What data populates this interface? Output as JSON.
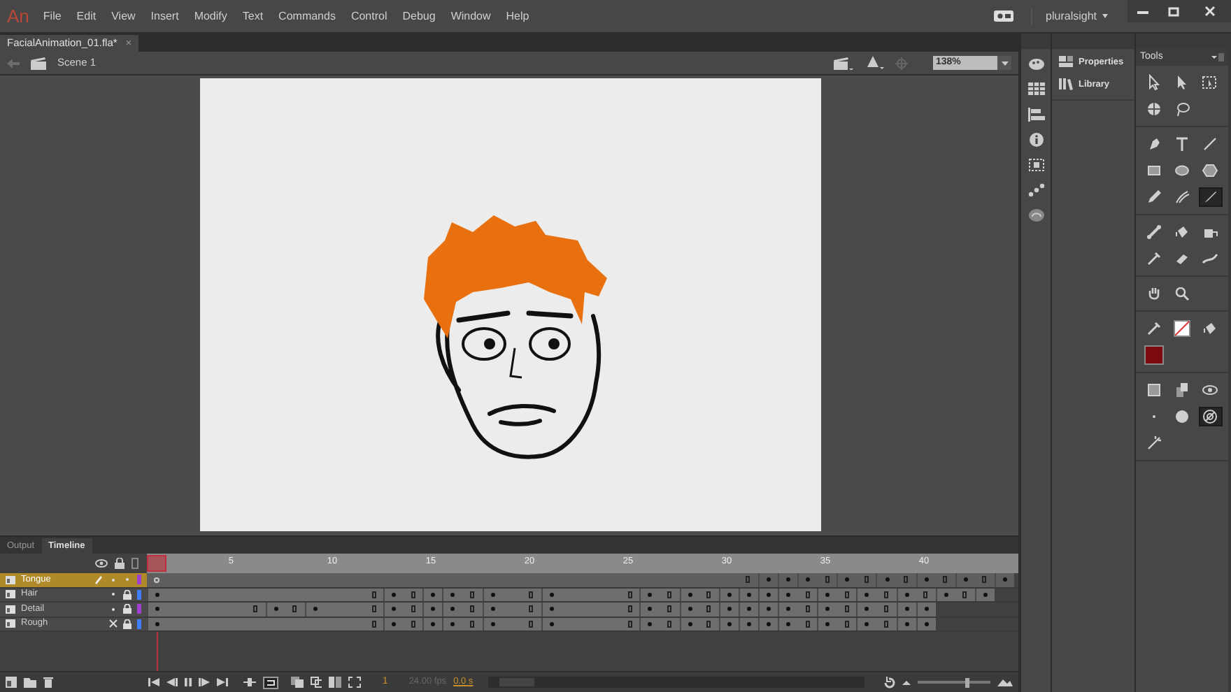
{
  "app": {
    "logo": "An",
    "menus": [
      "File",
      "Edit",
      "View",
      "Insert",
      "Modify",
      "Text",
      "Commands",
      "Control",
      "Debug",
      "Window",
      "Help"
    ],
    "account": "pluralsight"
  },
  "document_tab": {
    "title": "FacialAnimation_01.fla*",
    "close": "×"
  },
  "scene_bar": {
    "scene": "Scene 1",
    "zoom": "138%"
  },
  "dock_icons": [
    {
      "kind": "palette"
    },
    {
      "kind": "grid"
    },
    {
      "kind": "align"
    },
    {
      "kind": "info"
    },
    {
      "kind": "transform"
    },
    {
      "kind": "motion"
    },
    {
      "kind": "cloud"
    }
  ],
  "panels": [
    {
      "label": "Properties",
      "kind": "properties"
    },
    {
      "label": "Library",
      "kind": "library"
    }
  ],
  "tools": {
    "title": "Tools",
    "groups": [
      [
        {
          "kind": "select",
          "selected": false
        },
        {
          "kind": "subselect",
          "selected": false
        },
        {
          "kind": "transform",
          "selected": false
        },
        {
          "kind": "rotate3d",
          "selected": false
        },
        {
          "kind": "lasso",
          "selected": false
        }
      ],
      [
        {
          "kind": "pen",
          "selected": false
        },
        {
          "kind": "text",
          "selected": false
        },
        {
          "kind": "line",
          "selected": false
        },
        {
          "kind": "rect",
          "selected": false
        },
        {
          "kind": "oval",
          "selected": false
        },
        {
          "kind": "poly",
          "selected": false
        },
        {
          "kind": "pencil",
          "selected": false
        },
        {
          "kind": "paintbrush",
          "selected": false
        },
        {
          "kind": "brush",
          "selected": true
        }
      ],
      [
        {
          "kind": "bone",
          "selected": false
        },
        {
          "kind": "bucket",
          "selected": false
        },
        {
          "kind": "inkbottle",
          "selected": false
        },
        {
          "kind": "eyedropper",
          "selected": false
        },
        {
          "kind": "eraser",
          "selected": false
        },
        {
          "kind": "width",
          "selected": false
        }
      ],
      [
        {
          "kind": "hand",
          "selected": false
        },
        {
          "kind": "zoom",
          "selected": false
        }
      ],
      [
        {
          "kind": "eyedropper",
          "selected": false
        },
        {
          "kind": "noswatch",
          "selected": false
        },
        {
          "kind": "bucket",
          "selected": false
        },
        {
          "kind": "swatch",
          "color": "#7a0a0e"
        }
      ],
      [
        {
          "kind": "objectdraw",
          "selected": false
        },
        {
          "kind": "layerdepth",
          "selected": false
        },
        {
          "kind": "tilt",
          "selected": false
        },
        {
          "kind": "dot",
          "selected": false
        },
        {
          "kind": "circle",
          "selected": false
        },
        {
          "kind": "target",
          "selected": true
        },
        {
          "kind": "wand",
          "selected": false
        }
      ]
    ]
  },
  "timeline": {
    "tabs": [
      {
        "label": "Output",
        "selected": false
      },
      {
        "label": "Timeline",
        "selected": true
      }
    ],
    "ruler": [
      "5",
      "10",
      "15",
      "20",
      "25",
      "30",
      "35",
      "40"
    ],
    "layers": [
      {
        "name": "Tongue",
        "selected": true,
        "visible": true,
        "locked": false,
        "color": "#a040d0",
        "frames": [
          {
            "kind": "blank"
          },
          {
            "kind": "span"
          },
          {
            "kind": "span"
          },
          {
            "kind": "span"
          },
          {
            "kind": "span"
          },
          {
            "kind": "span"
          },
          {
            "kind": "span"
          },
          {
            "kind": "span"
          },
          {
            "kind": "span"
          },
          {
            "kind": "span"
          },
          {
            "kind": "span"
          },
          {
            "kind": "span"
          },
          {
            "kind": "span"
          },
          {
            "kind": "span"
          },
          {
            "kind": "span"
          },
          {
            "kind": "span"
          },
          {
            "kind": "span"
          },
          {
            "kind": "span"
          },
          {
            "kind": "span"
          },
          {
            "kind": "span"
          },
          {
            "kind": "span"
          },
          {
            "kind": "span"
          },
          {
            "kind": "span"
          },
          {
            "kind": "span"
          },
          {
            "kind": "span"
          },
          {
            "kind": "span"
          },
          {
            "kind": "span"
          },
          {
            "kind": "span"
          },
          {
            "kind": "span"
          },
          {
            "kind": "span"
          },
          {
            "kind": "end"
          },
          {
            "kind": "key"
          },
          {
            "kind": "key"
          },
          {
            "kind": "key"
          },
          {
            "kind": "end"
          },
          {
            "kind": "key"
          },
          {
            "kind": "end"
          },
          {
            "kind": "key"
          },
          {
            "kind": "end"
          },
          {
            "kind": "key"
          },
          {
            "kind": "end"
          },
          {
            "kind": "key"
          },
          {
            "kind": "end"
          },
          {
            "kind": "key"
          }
        ]
      },
      {
        "name": "Hair",
        "selected": false,
        "visible": true,
        "locked": true,
        "color": "#3f7fff",
        "frames": [
          {
            "kind": "key"
          },
          {
            "kind": "span"
          },
          {
            "kind": "span"
          },
          {
            "kind": "span"
          },
          {
            "kind": "span"
          },
          {
            "kind": "span"
          },
          {
            "kind": "span"
          },
          {
            "kind": "span"
          },
          {
            "kind": "span"
          },
          {
            "kind": "span"
          },
          {
            "kind": "span"
          },
          {
            "kind": "end"
          },
          {
            "kind": "key"
          },
          {
            "kind": "end"
          },
          {
            "kind": "key"
          },
          {
            "kind": "key"
          },
          {
            "kind": "end"
          },
          {
            "kind": "key"
          },
          {
            "kind": "span"
          },
          {
            "kind": "end"
          },
          {
            "kind": "key"
          },
          {
            "kind": "span"
          },
          {
            "kind": "span"
          },
          {
            "kind": "span"
          },
          {
            "kind": "end"
          },
          {
            "kind": "key"
          },
          {
            "kind": "end"
          },
          {
            "kind": "key"
          },
          {
            "kind": "end"
          },
          {
            "kind": "key"
          },
          {
            "kind": "key"
          },
          {
            "kind": "key"
          },
          {
            "kind": "key"
          },
          {
            "kind": "end"
          },
          {
            "kind": "key"
          },
          {
            "kind": "end"
          },
          {
            "kind": "key"
          },
          {
            "kind": "end"
          },
          {
            "kind": "key"
          },
          {
            "kind": "end"
          },
          {
            "kind": "key"
          },
          {
            "kind": "end"
          },
          {
            "kind": "key"
          },
          {
            "kind": "none"
          }
        ]
      },
      {
        "name": "Detail",
        "selected": false,
        "visible": true,
        "locked": true,
        "color": "#a040d0",
        "frames": [
          {
            "kind": "key"
          },
          {
            "kind": "span"
          },
          {
            "kind": "span"
          },
          {
            "kind": "span"
          },
          {
            "kind": "span"
          },
          {
            "kind": "end"
          },
          {
            "kind": "key"
          },
          {
            "kind": "end"
          },
          {
            "kind": "key"
          },
          {
            "kind": "span"
          },
          {
            "kind": "span"
          },
          {
            "kind": "end"
          },
          {
            "kind": "key"
          },
          {
            "kind": "end"
          },
          {
            "kind": "key"
          },
          {
            "kind": "key"
          },
          {
            "kind": "end"
          },
          {
            "kind": "key"
          },
          {
            "kind": "span"
          },
          {
            "kind": "end"
          },
          {
            "kind": "key"
          },
          {
            "kind": "span"
          },
          {
            "kind": "span"
          },
          {
            "kind": "span"
          },
          {
            "kind": "end"
          },
          {
            "kind": "key"
          },
          {
            "kind": "end"
          },
          {
            "kind": "key"
          },
          {
            "kind": "end"
          },
          {
            "kind": "key"
          },
          {
            "kind": "key"
          },
          {
            "kind": "key"
          },
          {
            "kind": "key"
          },
          {
            "kind": "end"
          },
          {
            "kind": "key"
          },
          {
            "kind": "end"
          },
          {
            "kind": "key"
          },
          {
            "kind": "end"
          },
          {
            "kind": "key"
          },
          {
            "kind": "key"
          },
          {
            "kind": "none"
          },
          {
            "kind": "none"
          },
          {
            "kind": "none"
          },
          {
            "kind": "none"
          }
        ]
      },
      {
        "name": "Rough",
        "selected": false,
        "visible": false,
        "locked": true,
        "color": "#3f7fff",
        "frames": [
          {
            "kind": "key"
          },
          {
            "kind": "span"
          },
          {
            "kind": "span"
          },
          {
            "kind": "span"
          },
          {
            "kind": "span"
          },
          {
            "kind": "span"
          },
          {
            "kind": "span"
          },
          {
            "kind": "span"
          },
          {
            "kind": "span"
          },
          {
            "kind": "span"
          },
          {
            "kind": "span"
          },
          {
            "kind": "end"
          },
          {
            "kind": "key"
          },
          {
            "kind": "end"
          },
          {
            "kind": "key"
          },
          {
            "kind": "key"
          },
          {
            "kind": "end"
          },
          {
            "kind": "key"
          },
          {
            "kind": "span"
          },
          {
            "kind": "end"
          },
          {
            "kind": "key"
          },
          {
            "kind": "span"
          },
          {
            "kind": "span"
          },
          {
            "kind": "span"
          },
          {
            "kind": "end"
          },
          {
            "kind": "key"
          },
          {
            "kind": "end"
          },
          {
            "kind": "key"
          },
          {
            "kind": "end"
          },
          {
            "kind": "key"
          },
          {
            "kind": "key"
          },
          {
            "kind": "key"
          },
          {
            "kind": "key"
          },
          {
            "kind": "end"
          },
          {
            "kind": "key"
          },
          {
            "kind": "end"
          },
          {
            "kind": "key"
          },
          {
            "kind": "end"
          },
          {
            "kind": "key"
          },
          {
            "kind": "key"
          },
          {
            "kind": "none"
          },
          {
            "kind": "none"
          },
          {
            "kind": "none"
          },
          {
            "kind": "none"
          }
        ]
      }
    ],
    "status": {
      "frame": "1",
      "fps": "24.00 fps",
      "time": "0.0 s"
    },
    "zoom_slider": {
      "level": 0.65
    }
  }
}
